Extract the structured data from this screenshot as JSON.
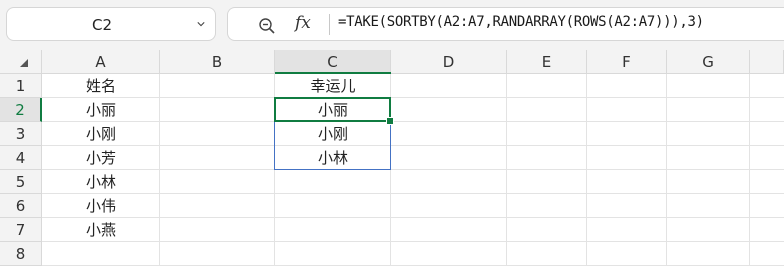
{
  "name_box": {
    "value": "C2"
  },
  "formula_bar": {
    "fx_label": "fx",
    "formula": "=TAKE(SORTBY(A2:A7,RANDARRAY(ROWS(A2:A7))),3)"
  },
  "columns": [
    "A",
    "B",
    "C",
    "D",
    "E",
    "F",
    "G"
  ],
  "rows": [
    "1",
    "2",
    "3",
    "4",
    "5",
    "6",
    "7",
    "8"
  ],
  "selected_column": "C",
  "selected_row": "2",
  "cells": {
    "A1": "姓名",
    "A2": "小丽",
    "A3": "小刚",
    "A4": "小芳",
    "A5": "小林",
    "A6": "小伟",
    "A7": "小燕",
    "C1": "幸运儿",
    "C2": "小丽",
    "C3": "小刚",
    "C4": "小林"
  },
  "colors": {
    "selection": "#107c41",
    "spill_border": "#4472c4"
  }
}
